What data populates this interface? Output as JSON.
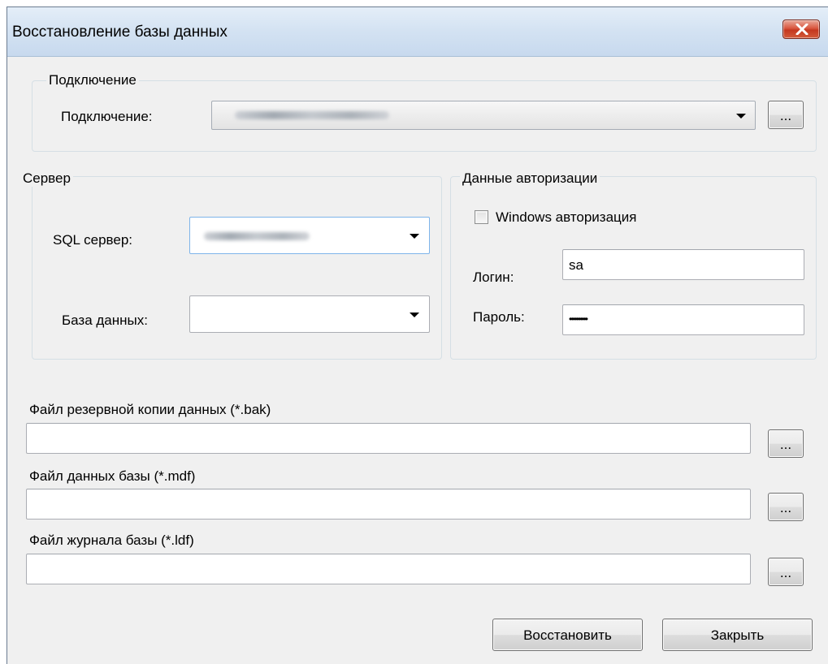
{
  "window": {
    "title": "Восстановление базы данных",
    "close_icon": "close-icon"
  },
  "connection_group": {
    "legend": "Подключение",
    "label": "Подключение:",
    "browse_label": "..."
  },
  "server_group": {
    "legend": "Сервер",
    "sql_server_label": "SQL сервер:",
    "database_label": "База данных:",
    "database_value": ""
  },
  "auth_group": {
    "legend": "Данные авторизации",
    "windows_auth_label": "Windows авторизация",
    "windows_auth_checked": false,
    "login_label": "Логин:",
    "login_value": "sa",
    "password_label": "Пароль:",
    "password_value": "••••••••••"
  },
  "files": {
    "bak_label": "Файл резервной копии данных (*.bak)",
    "bak_value": "",
    "mdf_label": "Файл данных базы (*.mdf)",
    "mdf_value": "",
    "ldf_label": "Файл журнала базы (*.ldf)",
    "ldf_value": "",
    "browse_label": "..."
  },
  "buttons": {
    "restore": "Восстановить",
    "close": "Закрыть"
  },
  "colors": {
    "titlebar": "#d3e2f2",
    "close_button": "#c4381f",
    "window_bg": "#f0f0f0"
  }
}
